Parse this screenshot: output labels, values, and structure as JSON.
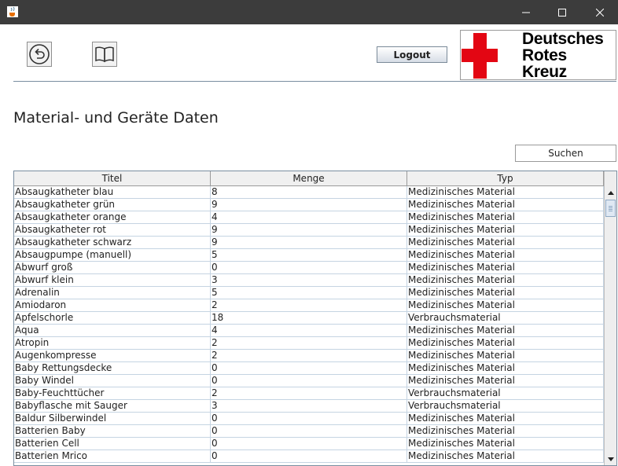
{
  "titlebar": {
    "icon": "java-cup-icon",
    "minimize": "minimize-icon",
    "maximize": "maximize-icon",
    "close": "close-icon"
  },
  "toolbar": {
    "back_icon": "back-arrow-icon",
    "manual_icon": "book-icon",
    "logout_label": "Logout"
  },
  "logo": {
    "line1": "Deutsches",
    "line2": "Rotes",
    "line3": "Kreuz",
    "cross_color": "#e30613"
  },
  "page": {
    "title": "Material- und Geräte Daten",
    "search_label": "Suchen"
  },
  "table": {
    "columns": [
      "Titel",
      "Menge",
      "Typ"
    ],
    "rows": [
      [
        "Absaugkatheter blau",
        "8",
        "Medizinisches Material"
      ],
      [
        "Absaugkatheter grün",
        "9",
        "Medizinisches Material"
      ],
      [
        "Absaugkatheter orange",
        "4",
        "Medizinisches Material"
      ],
      [
        "Absaugkatheter rot",
        "9",
        "Medizinisches Material"
      ],
      [
        "Absaugkatheter schwarz",
        "9",
        "Medizinisches Material"
      ],
      [
        "Absaugpumpe (manuell)",
        "5",
        "Medizinisches Material"
      ],
      [
        "Abwurf groß",
        "0",
        "Medizinisches Material"
      ],
      [
        "Abwurf klein",
        "3",
        "Medizinisches Material"
      ],
      [
        "Adrenalin",
        "5",
        "Medizinisches Material"
      ],
      [
        "Amiodaron",
        "2",
        "Medizinisches Material"
      ],
      [
        "Apfelschorle",
        "18",
        "Verbrauchsmaterial"
      ],
      [
        "Aqua",
        "4",
        "Medizinisches Material"
      ],
      [
        "Atropin",
        "2",
        "Medizinisches Material"
      ],
      [
        "Augenkompresse",
        "2",
        "Medizinisches Material"
      ],
      [
        "Baby Rettungsdecke",
        "0",
        "Medizinisches Material"
      ],
      [
        "Baby Windel",
        "0",
        "Medizinisches Material"
      ],
      [
        "Baby-Feuchttücher",
        "2",
        "Verbrauchsmaterial"
      ],
      [
        "Babyflasche mit Sauger",
        "3",
        "Verbrauchsmaterial"
      ],
      [
        "Baldur Silberwindel",
        "0",
        "Medizinisches Material"
      ],
      [
        "Batterien Baby",
        "0",
        "Medizinisches Material"
      ],
      [
        "Batterien Cell",
        "0",
        "Medizinisches Material"
      ],
      [
        "Batterien Mrico",
        "0",
        "Medizinisches Material"
      ]
    ]
  }
}
